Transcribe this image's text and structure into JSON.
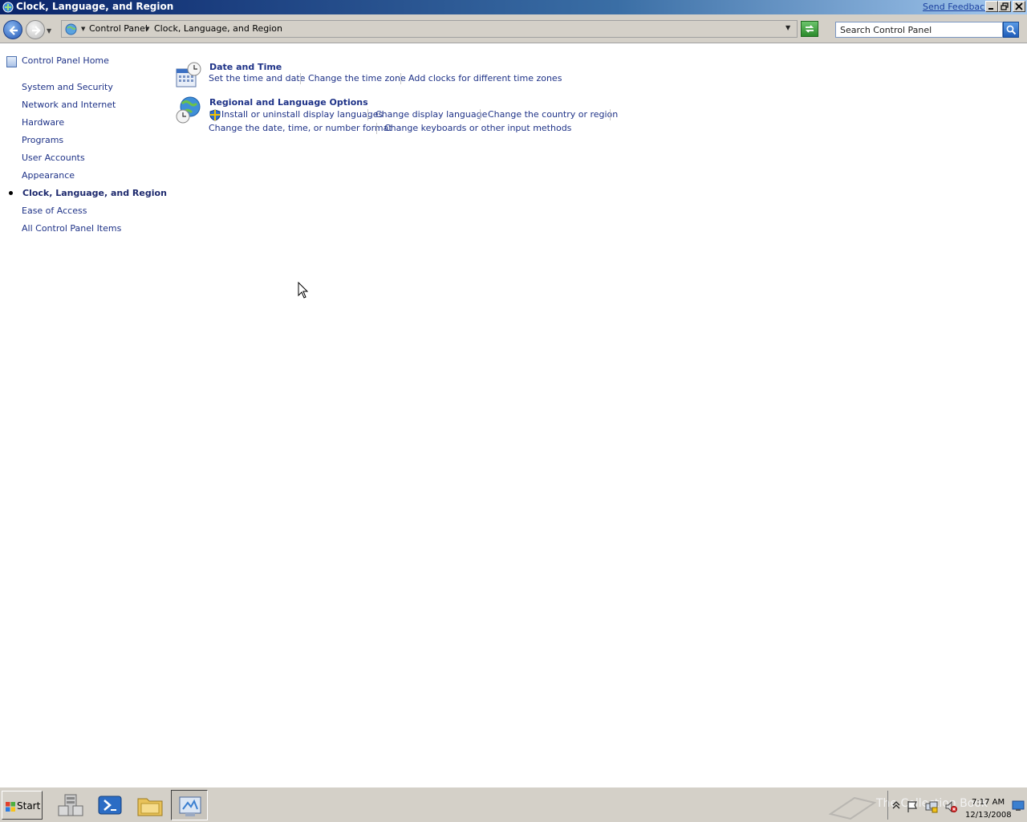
{
  "window": {
    "title": "Clock, Language, and Region",
    "send_feedback": "Send Feedback"
  },
  "address": {
    "crumbs": [
      "Control Panel",
      "Clock, Language, and Region"
    ],
    "search_placeholder": "Search Control Panel"
  },
  "sidebar": {
    "home": "Control Panel Home",
    "items": [
      "System and Security",
      "Network and Internet",
      "Hardware",
      "Programs",
      "User Accounts",
      "Appearance",
      "Clock, Language, and Region",
      "Ease of Access",
      "All Control Panel Items"
    ],
    "current_index": 6
  },
  "categories": [
    {
      "title": "Date and Time",
      "icon": "calendar-clock-icon",
      "tasks": [
        "Set the time and date",
        "Change the time zone",
        "Add clocks for different time zones"
      ]
    },
    {
      "title": "Regional and Language Options",
      "icon": "globe-clock-icon",
      "tasks": [
        "Install or uninstall display languages",
        "Change display language",
        "Change the country or region",
        "Change the date, time, or number format",
        "Change keyboards or other input methods"
      ]
    }
  ],
  "taskbar": {
    "start_label": "Start",
    "apps": [
      "server-manager-icon",
      "powershell-icon",
      "explorer-icon",
      "control-panel-icon"
    ],
    "active_app": "control-panel-icon",
    "watermark": "The Collection Book",
    "clock_time": "7:17 AM",
    "clock_date": "12/13/2008"
  }
}
